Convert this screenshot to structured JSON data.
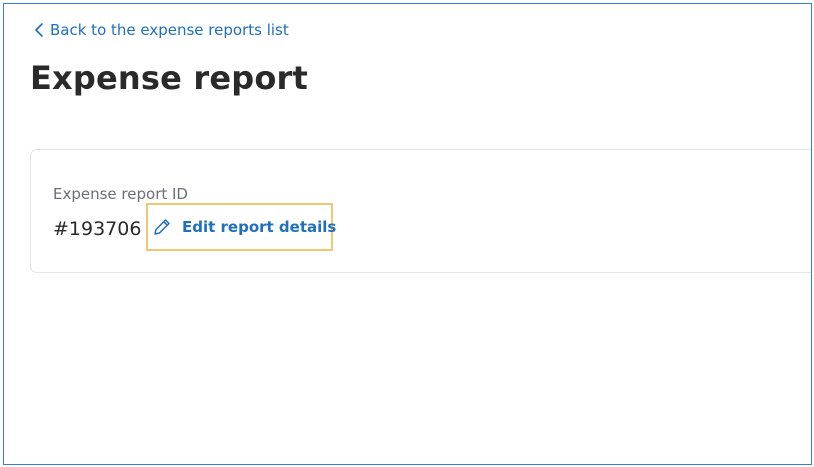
{
  "navigation": {
    "back_label": "Back to the expense reports list",
    "back_icon": "chevron-left-icon"
  },
  "page": {
    "title": "Expense report"
  },
  "report": {
    "id_label": "Expense report ID",
    "id_value": "#193706",
    "edit_label": "Edit report details",
    "edit_icon": "pencil-icon"
  },
  "colors": {
    "link": "#1f6fbf",
    "frame_border": "#3b7dd8",
    "highlight": "#f3c570",
    "title_text": "#2a2a2a",
    "label_text": "#6b6f76",
    "card_border": "#e2e4e8"
  }
}
